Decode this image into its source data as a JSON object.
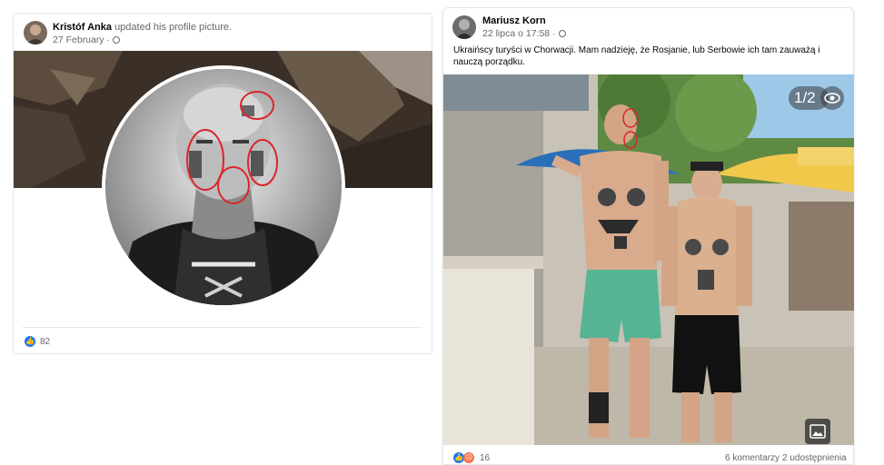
{
  "left_post": {
    "author": "Kristóf Anka",
    "action": "updated his profile picture.",
    "date": "27 February",
    "privacy_icon": "globe-icon",
    "reaction_icon": "like-icon",
    "reaction_count": "82"
  },
  "right_post": {
    "author": "Mariusz Korn",
    "date": "22 lipca o 17:58",
    "privacy_icon": "globe-icon",
    "caption": "Ukraińscy turyści w Chorwacji. Mam nadzieję, że Rosjanie, lub Serbowie ich tam zauważą i nauczą porządku.",
    "photo_counter": "1/2",
    "reaction_icons": [
      "like-icon",
      "angry-icon"
    ],
    "reaction_count": "16",
    "comments": "6 komentarzy",
    "shares": "2 udostępnienia"
  },
  "colors": {
    "accent_blue": "#1877f2",
    "angry_orange": "#f7714b",
    "annotation_red": "#d9262c",
    "muted_text": "#65676b"
  }
}
